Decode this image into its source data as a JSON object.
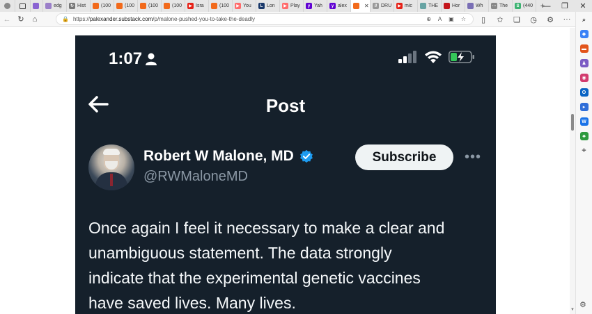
{
  "browser": {
    "tabs": [
      {
        "label": "",
        "color": "#8a63d2",
        "glyph": ""
      },
      {
        "label": "edg",
        "color": "#9b7fc9",
        "glyph": ""
      },
      {
        "label": "Hist",
        "color": "#777777",
        "glyph": "↻"
      },
      {
        "label": "(100",
        "color": "#f26a1b",
        "glyph": ""
      },
      {
        "label": "(100",
        "color": "#f26a1b",
        "glyph": ""
      },
      {
        "label": "(100",
        "color": "#f26a1b",
        "glyph": ""
      },
      {
        "label": "(100",
        "color": "#f26a1b",
        "glyph": ""
      },
      {
        "label": "Isra",
        "color": "#e62117",
        "glyph": "▶"
      },
      {
        "label": "(100",
        "color": "#f26a1b",
        "glyph": ""
      },
      {
        "label": "You",
        "color": "#ff6b6b",
        "glyph": "▶"
      },
      {
        "label": "Lon",
        "color": "#1b3a6b",
        "glyph": "L"
      },
      {
        "label": "Play",
        "color": "#ff6b6b",
        "glyph": "▶"
      },
      {
        "label": "Yah",
        "color": "#6001d2",
        "glyph": "y"
      },
      {
        "label": "alex",
        "color": "#6001d2",
        "glyph": "y"
      },
      {
        "label": "",
        "color": "#f26a1b",
        "glyph": "",
        "active": true
      },
      {
        "label": "DRU",
        "color": "#999999",
        "glyph": "//"
      },
      {
        "label": "mic",
        "color": "#e62117",
        "glyph": "▶"
      },
      {
        "label": "THE",
        "color": "#66a3a3",
        "glyph": ""
      },
      {
        "label": "Hor",
        "color": "#c4161c",
        "glyph": ""
      },
      {
        "label": "Wh",
        "color": "#7a6fb5",
        "glyph": ""
      },
      {
        "label": "The",
        "color": "#888888",
        "glyph": "···"
      },
      {
        "label": "(440",
        "color": "#3cb371",
        "glyph": "S"
      }
    ],
    "new_tab_label": "+",
    "url_prefix": "https://",
    "url_host": "palexander.substack.com",
    "url_path": "/p/malone-pushed-you-to-take-the-deadly",
    "window_controls": {
      "minimize": "—",
      "restore": "❐",
      "close": "✕"
    }
  },
  "phone": {
    "status_time": "1:07",
    "title": "Post",
    "display_name": "Robert W Malone, MD",
    "handle": "@RWMaloneMD",
    "subscribe_label": "Subscribe",
    "more": "•••",
    "tweet_lines": [
      "Once again I feel it necessary to make a clear and",
      "unambiguous statement. The data strongly",
      "indicate that the experimental genetic vaccines",
      "have saved lives. Many lives."
    ]
  }
}
